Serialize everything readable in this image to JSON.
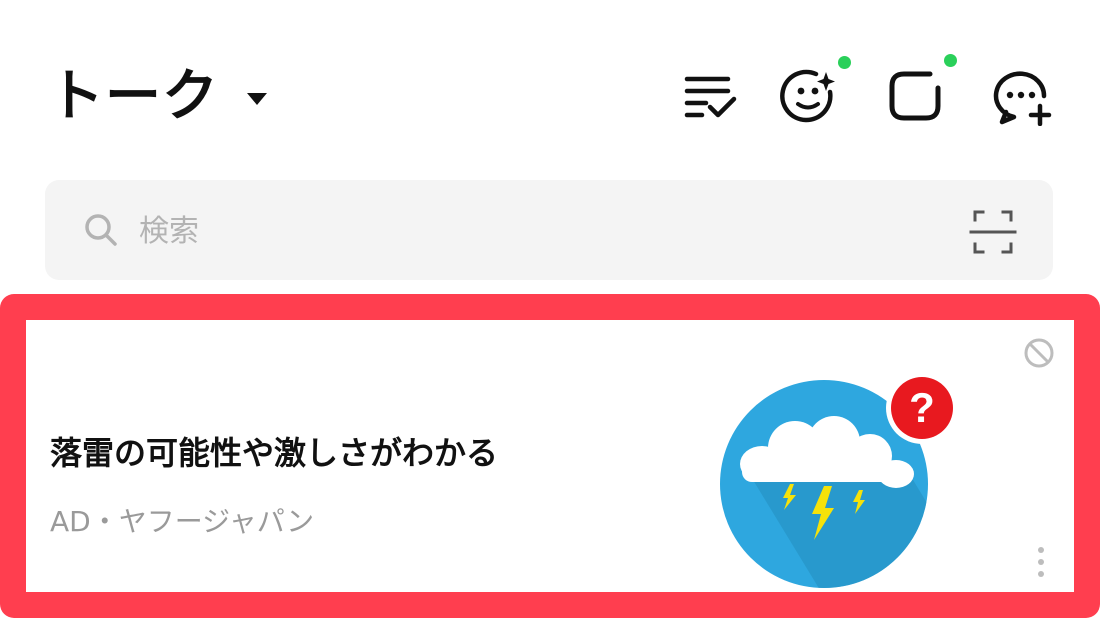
{
  "header": {
    "title": "トーク",
    "icons": [
      "checklist-icon",
      "face-sparkle-icon",
      "voom-square-icon",
      "new-chat-icon"
    ],
    "notification_dot_color": "#2ad05a"
  },
  "search": {
    "placeholder": "検索",
    "icons": [
      "search-icon",
      "scan-icon"
    ]
  },
  "ad": {
    "title": "落雷の可能性や激しさがわかる",
    "sponsor": "AD・ヤフージャパン",
    "image_icon": "thunderstorm-cloud-icon",
    "badge_text": "?",
    "highlight_color": "#ff3e4f"
  }
}
